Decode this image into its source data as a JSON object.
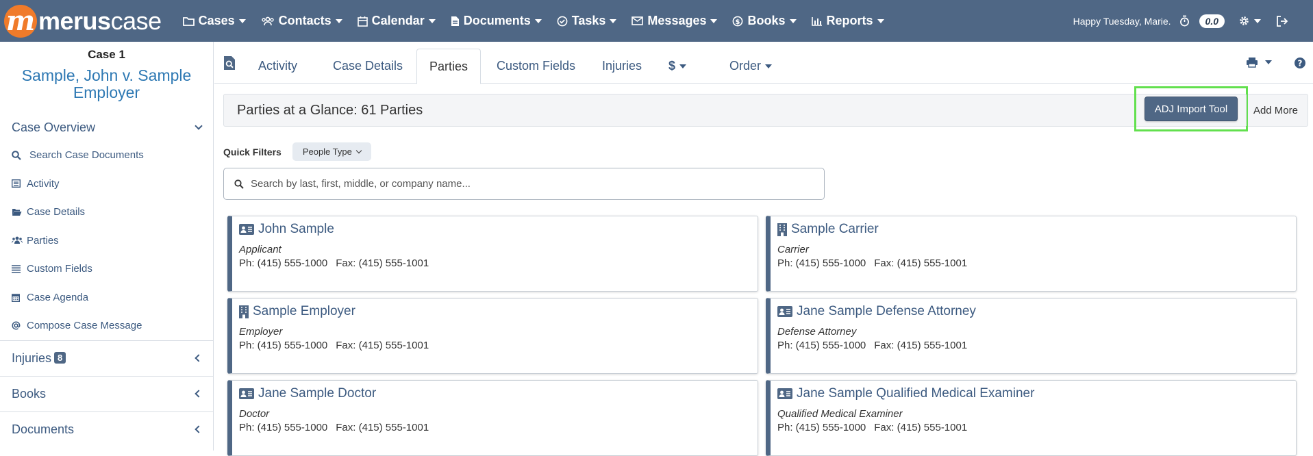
{
  "app": {
    "logo_text_bold": "merus",
    "logo_text_light": "case",
    "logo_glyph": "m"
  },
  "nav": {
    "items": [
      {
        "label": "Cases",
        "icon": "folder-icon"
      },
      {
        "label": "Contacts",
        "icon": "users-icon"
      },
      {
        "label": "Calendar",
        "icon": "calendar-icon"
      },
      {
        "label": "Documents",
        "icon": "document-icon"
      },
      {
        "label": "Tasks",
        "icon": "check-circle-icon"
      },
      {
        "label": "Messages",
        "icon": "envelope-icon"
      },
      {
        "label": "Books",
        "icon": "dollar-circle-icon"
      },
      {
        "label": "Reports",
        "icon": "bar-chart-icon"
      }
    ],
    "greeting": "Happy Tuesday, Marie.",
    "timer_value": "0.0"
  },
  "sidebar": {
    "case_label": "Case 1",
    "case_name": "Sample, John v. Sample Employer",
    "overview_label": "Case Overview",
    "links": [
      {
        "label": "Search Case Documents",
        "icon": "search-icon"
      },
      {
        "label": "Activity",
        "icon": "list-icon"
      },
      {
        "label": "Case Details",
        "icon": "folder-open-icon"
      },
      {
        "label": "Parties",
        "icon": "users-icon"
      },
      {
        "label": "Custom Fields",
        "icon": "lines-icon"
      },
      {
        "label": "Case Agenda",
        "icon": "calendar-icon"
      },
      {
        "label": "Compose Case Message",
        "icon": "at-icon"
      }
    ],
    "sections": [
      {
        "label": "Injuries",
        "badge": "8"
      },
      {
        "label": "Books"
      },
      {
        "label": "Documents"
      }
    ]
  },
  "tabs": {
    "items": [
      "Activity",
      "Case Details",
      "Parties",
      "Custom Fields",
      "Injuries",
      "$",
      "Order"
    ],
    "active": "Parties"
  },
  "glance": {
    "title": "Parties at a Glance: 61 Parties",
    "adj_button": "ADJ Import Tool",
    "add_more": "Add More"
  },
  "quick_filters": {
    "label": "Quick Filters",
    "people_type": "People Type"
  },
  "search": {
    "placeholder": "Search by last, first, middle, or company name..."
  },
  "parties": [
    {
      "name": "John Sample",
      "role": "Applicant",
      "phone": "Ph: (415) 555-1000",
      "fax": "Fax: (415) 555-1001",
      "icon": "id-card-icon"
    },
    {
      "name": "Sample Carrier",
      "role": "Carrier",
      "phone": "Ph: (415) 555-1000",
      "fax": "Fax: (415) 555-1001",
      "icon": "building-icon"
    },
    {
      "name": "Sample Employer",
      "role": "Employer",
      "phone": "Ph: (415) 555-1000",
      "fax": "Fax: (415) 555-1001",
      "icon": "building-icon"
    },
    {
      "name": "Jane Sample Defense Attorney",
      "role": "Defense Attorney",
      "phone": "Ph: (415) 555-1000",
      "fax": "Fax: (415) 555-1001",
      "icon": "id-card-icon"
    },
    {
      "name": "Jane Sample Doctor",
      "role": "Doctor",
      "phone": "Ph: (415) 555-1000",
      "fax": "Fax: (415) 555-1001",
      "icon": "id-card-icon"
    },
    {
      "name": "Jane Sample Qualified Medical Examiner",
      "role": "Qualified Medical Examiner",
      "phone": "Ph: (415) 555-1000",
      "fax": "Fax: (415) 555-1001",
      "icon": "id-card-icon"
    }
  ],
  "colors": {
    "nav_bg": "#4f6785",
    "logo_orange": "#f07b2a",
    "link_blue": "#3c5a80",
    "highlight_green": "#62e04e"
  }
}
